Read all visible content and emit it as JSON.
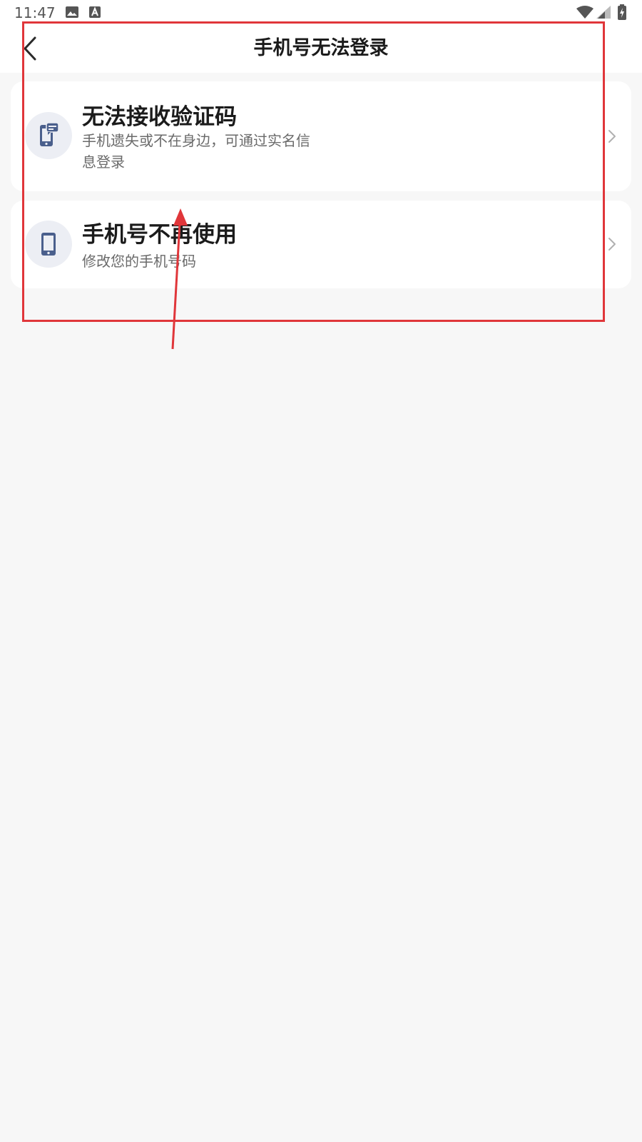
{
  "status_bar": {
    "time": "11:47",
    "icons": [
      "image-icon",
      "a-letter-icon",
      "wifi-icon",
      "signal-icon",
      "battery-icon"
    ]
  },
  "app_bar": {
    "back_icon": "chevron-left-icon",
    "title": "手机号无法登录"
  },
  "options": [
    {
      "icon": "phone-message-icon",
      "title": "无法接收验证码",
      "description": "手机遗失或不在身边，可通过实名信息登录"
    },
    {
      "icon": "phone-icon",
      "title": "手机号不再使用",
      "description": "修改您的手机号码"
    }
  ],
  "colors": {
    "background": "#f7f7f7",
    "card": "#ffffff",
    "icon_circle": "#eceef4",
    "icon_blue": "#4a5f8c",
    "annotation_red": "#e0363a"
  }
}
